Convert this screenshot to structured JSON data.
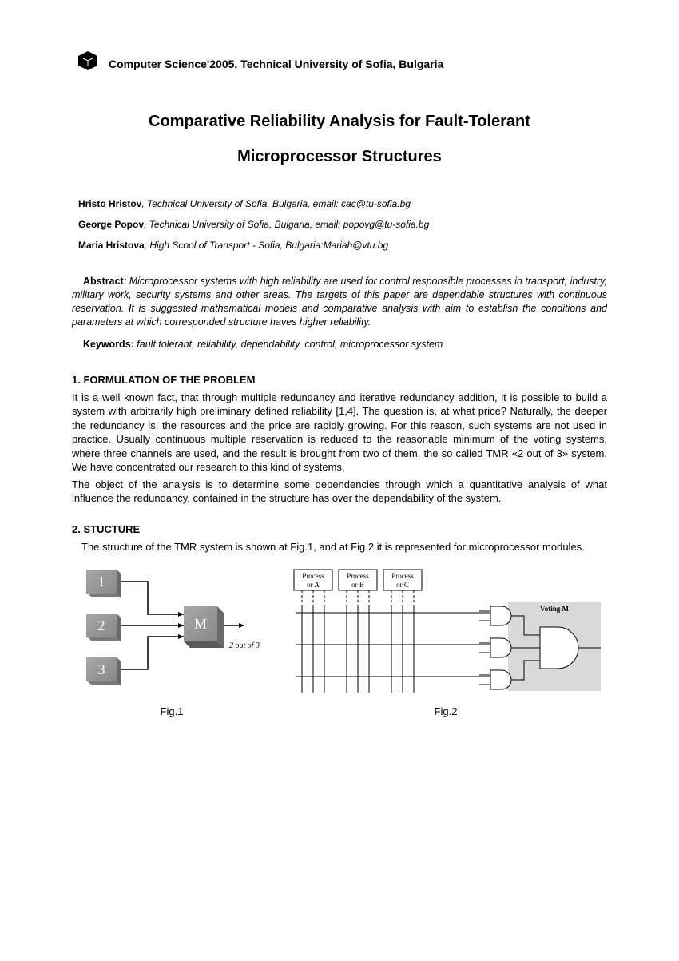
{
  "header": {
    "conference": "Computer Science'2005, Technical University of Sofia, Bulgaria"
  },
  "title_line1": "Comparative Reliability Analysis for Fault-Tolerant",
  "title_line2": "Microprocessor Structures",
  "authors": [
    {
      "name": "Hristo Hristov",
      "affil": ", Technical University of Sofia, Bulgaria, email: cac@tu-sofia.bg"
    },
    {
      "name": "George Popov",
      "affil": ", Technical University of Sofia, Bulgaria, email: popovg@tu-sofia.bg"
    },
    {
      "name": "Maria Hristova",
      "affil": ", High Scool of Transport - Sofia, Bulgaria:Mariah@vtu.bg"
    }
  ],
  "abstract": {
    "label": "Abstract",
    "text": ":  Microprocessor systems with high reliability are used for control responsible processes in transport, industry, military work, security systems and other areas.  The targets of this paper are dependable structures with continuous reservation. It is suggested mathematical models and comparative analysis with aim to establish the conditions and parameters at which corresponded structure haves higher reliability."
  },
  "keywords": {
    "label": "Keywords:",
    "text": " fault tolerant, reliability, dependability, control, microprocessor system"
  },
  "section1": {
    "heading": "1. FORMULATION OF THE PROBLEM",
    "p1": "It is a well known fact, that through multiple redundancy and iterative redundancy addition, it is possible to build a system with   arbitrarily high preliminary defined reliability [1,4]. The question is, at what price? Naturally, the deeper the redundancy is, the resources and the price are rapidly growing. For this reason, such systems are not used in practice.  Usually continuous multiple reservation is reduced to the reasonable minimum of the voting systems, where three channels are used, and the result is brought from two of them, the so called TMR «2 out of 3» system. We have concentrated our research to this kind of systems.",
    "p2": "The object of the analysis is to determine some dependencies through which a quantitative analysis of what influence the redundancy, contained in the structure has over the dependability of the system."
  },
  "section2": {
    "heading": "2. STUCTURE",
    "p1": "The structure of the TMR system is shown at Fig.1, and at Fig.2 it is represented for microprocessor modules."
  },
  "fig1": {
    "caption": "Fig.1",
    "blocks": {
      "b1": "1",
      "b2": "2",
      "b3": "3",
      "m": "M"
    },
    "label": "2 out of 3"
  },
  "fig2": {
    "caption": "Fig.2",
    "procA": "Process or A",
    "procB": "Process or B",
    "procC": "Process or C",
    "voting": "Voting M"
  }
}
